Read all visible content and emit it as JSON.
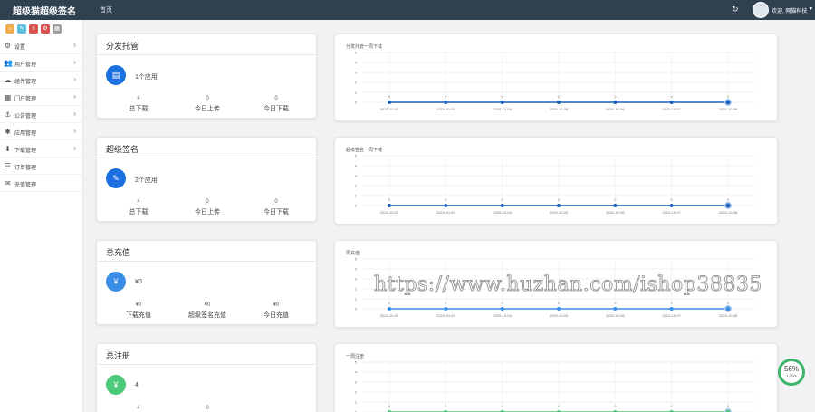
{
  "header": {
    "brand": "超级猫超级签名",
    "home_link": "首页",
    "welcome": "欢迎, 网猫科技"
  },
  "sidebar": {
    "quick_buttons": [
      {
        "icon": "home-icon",
        "color": "#f0ad4e"
      },
      {
        "icon": "edit-icon",
        "color": "#5bc0de"
      },
      {
        "icon": "list-icon",
        "color": "#d9534f"
      },
      {
        "icon": "settings-icon",
        "color": "#d9534f"
      },
      {
        "icon": "grid-icon",
        "color": "#9e9e9e"
      }
    ],
    "items": [
      {
        "label": "设置",
        "icon": "gears-icon",
        "glyph": "⚙",
        "has_arrow": true
      },
      {
        "label": "用户管理",
        "icon": "users-icon",
        "glyph": "👥",
        "has_arrow": true
      },
      {
        "label": "组件管理",
        "icon": "cloud-icon",
        "glyph": "☁",
        "has_arrow": true
      },
      {
        "label": "门户管理",
        "icon": "grid-icon",
        "glyph": "▦",
        "has_arrow": true
      },
      {
        "label": "公告管理",
        "icon": "anchor-icon",
        "glyph": "⚓",
        "has_arrow": true
      },
      {
        "label": "应用管理",
        "icon": "bug-icon",
        "glyph": "✱",
        "has_arrow": true
      },
      {
        "label": "下载管理",
        "icon": "download-icon",
        "glyph": "⬇",
        "has_arrow": true
      },
      {
        "label": "订单管理",
        "icon": "order-icon",
        "glyph": "☰",
        "has_arrow": false
      },
      {
        "label": "充值管理",
        "icon": "envelope-icon",
        "glyph": "✉",
        "has_arrow": false
      }
    ]
  },
  "stats": [
    {
      "title": "分发托管",
      "circle_color": "#1c6fe0",
      "circle_glyph": "▤",
      "main": "1个应用",
      "cols": [
        {
          "value": "4",
          "label": "总下载"
        },
        {
          "value": "0",
          "label": "今日上传"
        },
        {
          "value": "0",
          "label": "今日下载"
        }
      ]
    },
    {
      "title": "超级签名",
      "circle_color": "#1c6fe0",
      "circle_glyph": "✎",
      "main": "2个应用",
      "cols": [
        {
          "value": "4",
          "label": "总下载"
        },
        {
          "value": "0",
          "label": "今日上传"
        },
        {
          "value": "0",
          "label": "今日下载"
        }
      ]
    },
    {
      "title": "总充值",
      "circle_color": "#3a8ee6",
      "circle_glyph": "¥",
      "main": "¥0",
      "cols": [
        {
          "value": "¥0",
          "label": "下载充值"
        },
        {
          "value": "¥0",
          "label": "超级签名充值"
        },
        {
          "value": "¥0",
          "label": "今日充值"
        }
      ]
    },
    {
      "title": "总注册",
      "circle_color": "#4cc97a",
      "circle_glyph": "¥",
      "main": "4",
      "cols": [
        {
          "value": "4",
          "label": ""
        },
        {
          "value": "0",
          "label": ""
        },
        {
          "value": "",
          "label": ""
        }
      ]
    }
  ],
  "charts": [
    {
      "title": "分发托管一周下载",
      "line_color": "#1c5fb8",
      "chart_data": {
        "type": "line",
        "x": [
          "2020-10-02",
          "2020-10-03",
          "2020-10-04",
          "2020-10-05",
          "2020-10-06",
          "2020-10-07",
          "2020-10-08"
        ],
        "series": [
          {
            "values": [
              0,
              0,
              0,
              0,
              0,
              0,
              0
            ]
          }
        ],
        "ylim": [
          0,
          5
        ],
        "yticks": [
          "0",
          "1",
          "2",
          "3",
          "4",
          "5"
        ]
      }
    },
    {
      "title": "超级签名一周下载",
      "line_color": "#1c5fb8",
      "chart_data": {
        "type": "line",
        "x": [
          "2020-10-02",
          "2020-10-03",
          "2020-10-04",
          "2020-10-05",
          "2020-10-06",
          "2020-10-07",
          "2020-10-08"
        ],
        "series": [
          {
            "values": [
              0,
              0,
              0,
              0,
              0,
              0,
              0
            ]
          }
        ],
        "ylim": [
          0,
          5
        ],
        "yticks": [
          "0",
          "1",
          "2",
          "3",
          "4",
          "5"
        ]
      }
    },
    {
      "title": "周充值",
      "line_color": "#3a8ee6",
      "chart_data": {
        "type": "line",
        "x": [
          "2020-10-02",
          "2020-10-03",
          "2020-10-04",
          "2020-10-05",
          "2020-10-06",
          "2020-10-07",
          "2020-10-08"
        ],
        "series": [
          {
            "values": [
              0,
              0,
              0,
              0,
              0,
              0,
              0
            ]
          }
        ],
        "ylim": [
          0,
          5
        ],
        "yticks": [
          "0",
          "1",
          "2",
          "3",
          "4",
          "5"
        ]
      }
    },
    {
      "title": "一周注册",
      "line_color": "#4cc97a",
      "chart_data": {
        "type": "line",
        "x": [],
        "series": [
          {
            "values": [
              0,
              0,
              0,
              0,
              0,
              0,
              0
            ]
          }
        ],
        "ylim": [
          0,
          5
        ],
        "yticks": [
          "0",
          "1",
          "2",
          "3",
          "4",
          "5"
        ]
      }
    }
  ],
  "watermark": "https://www.huzhan.com/ishop38835",
  "gauge": {
    "value": "56%",
    "sub": "1.9K/s"
  }
}
